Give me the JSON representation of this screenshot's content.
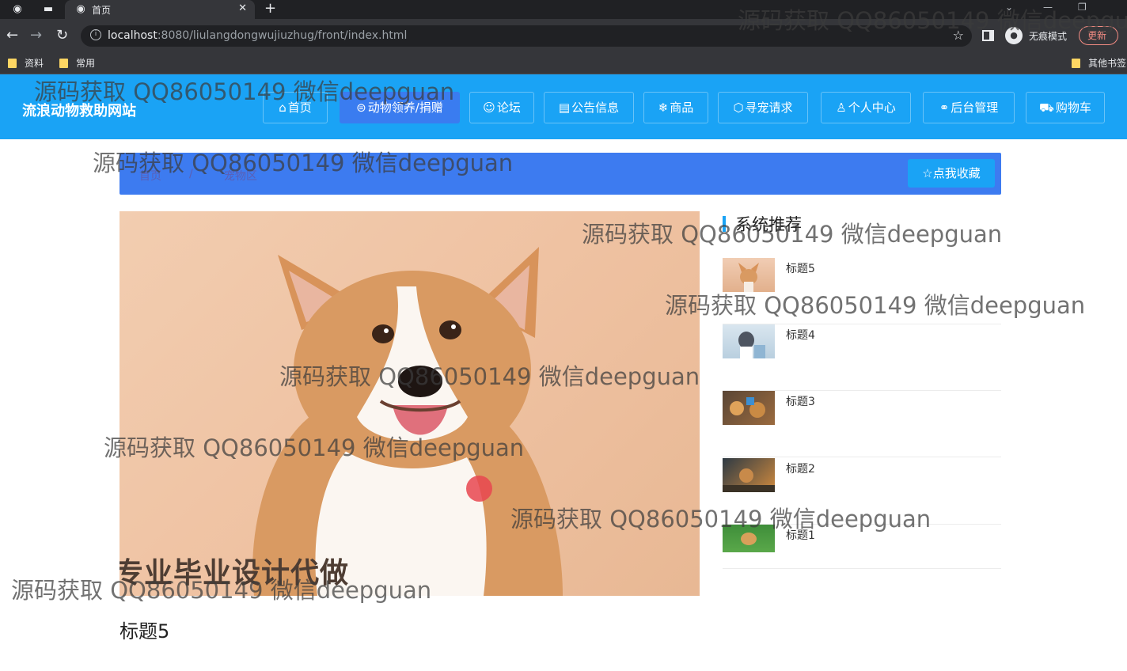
{
  "browser": {
    "tab_title": "首页",
    "new_tab": "+",
    "url_host": "localhost",
    "url_rest": ":8080/liulangdongwujiuzhug/front/index.html",
    "incognito_label": "无痕模式",
    "update_label": "更新",
    "bookmarks": [
      "资料",
      "常用"
    ],
    "other_bookmarks": "其他书签"
  },
  "site": {
    "title": "流浪动物救助网站",
    "nav": [
      {
        "icon": "⌂",
        "label": "首页"
      },
      {
        "icon": "⊜",
        "label": "动物领养/捐赠"
      },
      {
        "icon": "☺",
        "label": "论坛"
      },
      {
        "icon": "▤",
        "label": "公告信息"
      },
      {
        "icon": "❄",
        "label": "商品"
      },
      {
        "icon": "⬡",
        "label": "寻宠请求"
      },
      {
        "icon": "♙",
        "label": "个人中心"
      },
      {
        "icon": "⚭",
        "label": "后台管理"
      },
      {
        "icon": "⛟",
        "label": "购物车"
      }
    ]
  },
  "breadcrumb": {
    "home": "首页",
    "sep": "/",
    "current": "宠物区"
  },
  "favorite_button": "点我收藏",
  "favorite_icon": "☆",
  "promo_text": "专业毕业设计代做",
  "detail_title": "标题5",
  "recommend": {
    "heading": "系统推荐",
    "items": [
      {
        "label": "标题5",
        "thumb": "corgi"
      },
      {
        "label": "标题4",
        "thumb": "husky"
      },
      {
        "label": "标题3",
        "thumb": "puppies"
      },
      {
        "label": "标题2",
        "thumb": "dog-in-sunset"
      },
      {
        "label": "标题1",
        "thumb": "dog-on-grass"
      }
    ]
  },
  "watermark": "源码获取 QQ86050149 微信deepguan",
  "colors": {
    "header": "#1aa3f5",
    "nav_active": "#3a7cf0",
    "crumbbar": "#3d7bf0",
    "accent_bar": "#1aa3f5"
  }
}
